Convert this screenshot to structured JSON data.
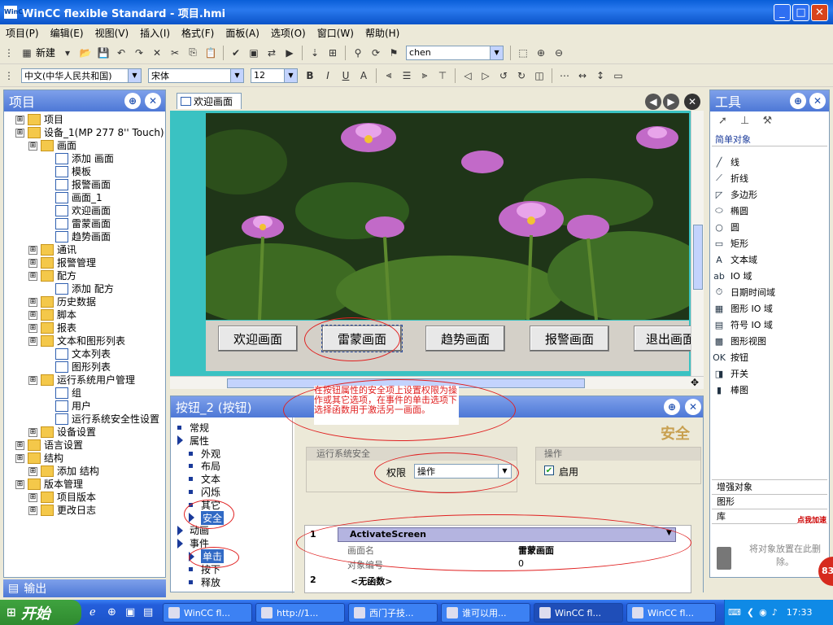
{
  "window": {
    "title": "WinCC flexible Standard - 项目.hmi",
    "app_icon": "WinCC"
  },
  "menu": [
    "项目(P)",
    "编辑(E)",
    "视图(V)",
    "插入(I)",
    "格式(F)",
    "面板(A)",
    "选项(O)",
    "窗口(W)",
    "帮助(H)"
  ],
  "toolbar": {
    "new_label": "新建",
    "user_combo": "chen",
    "language_combo": "中文(中华人民共和国)",
    "font_combo": "宋体",
    "size_combo": "12"
  },
  "project": {
    "title": "项目",
    "items": [
      {
        "label": "项目",
        "level": 0
      },
      {
        "label": "设备_1(MP 277 8'' Touch)",
        "level": 0
      },
      {
        "label": "画面",
        "level": 1
      },
      {
        "label": "添加 画面",
        "level": 2
      },
      {
        "label": "模板",
        "level": 2
      },
      {
        "label": "报警画面",
        "level": 2
      },
      {
        "label": "画面_1",
        "level": 2
      },
      {
        "label": "欢迎画面",
        "level": 2
      },
      {
        "label": "雷蒙画面",
        "level": 2
      },
      {
        "label": "趋势画面",
        "level": 2
      },
      {
        "label": "通讯",
        "level": 1
      },
      {
        "label": "报警管理",
        "level": 1
      },
      {
        "label": "配方",
        "level": 1
      },
      {
        "label": "添加 配方",
        "level": 2
      },
      {
        "label": "历史数据",
        "level": 1
      },
      {
        "label": "脚本",
        "level": 1
      },
      {
        "label": "报表",
        "level": 1
      },
      {
        "label": "文本和图形列表",
        "level": 1
      },
      {
        "label": "文本列表",
        "level": 2
      },
      {
        "label": "图形列表",
        "level": 2
      },
      {
        "label": "运行系统用户管理",
        "level": 1
      },
      {
        "label": "组",
        "level": 2
      },
      {
        "label": "用户",
        "level": 2
      },
      {
        "label": "运行系统安全性设置",
        "level": 2
      },
      {
        "label": "设备设置",
        "level": 1
      },
      {
        "label": "语言设置",
        "level": 0
      },
      {
        "label": "结构",
        "level": 0
      },
      {
        "label": "添加 结构",
        "level": 1
      },
      {
        "label": "版本管理",
        "level": 0
      },
      {
        "label": "项目版本",
        "level": 1
      },
      {
        "label": "更改日志",
        "level": 1
      }
    ]
  },
  "output": {
    "title": "输出"
  },
  "editor": {
    "tab": "欢迎画面",
    "screen_buttons": [
      "欢迎画面",
      "雷蒙画面",
      "趋势画面",
      "报警画面",
      "退出画面"
    ]
  },
  "annotation": {
    "text": "在按钮属性的安全项上设置权限为操作或其它选项，在事件的单击选项下选择函数用于激活另一画面。"
  },
  "properties": {
    "title": "按钮_2 (按钮)",
    "nav": [
      {
        "label": "常规",
        "kind": "item"
      },
      {
        "label": "属性",
        "kind": "group"
      },
      {
        "label": "外观",
        "kind": "item"
      },
      {
        "label": "布局",
        "kind": "item"
      },
      {
        "label": "文本",
        "kind": "item"
      },
      {
        "label": "闪烁",
        "kind": "item"
      },
      {
        "label": "其它",
        "kind": "item"
      },
      {
        "label": "安全",
        "kind": "selected"
      },
      {
        "label": "动画",
        "kind": "group"
      },
      {
        "label": "事件",
        "kind": "group"
      },
      {
        "label": "单击",
        "kind": "selected"
      },
      {
        "label": "按下",
        "kind": "item"
      },
      {
        "label": "释放",
        "kind": "item"
      }
    ],
    "security_heading": "安全",
    "runtime_security": "运行系统安全",
    "permission_label": "权限",
    "permission_value": "操作",
    "operation_label": "操作",
    "enable_label": "启用",
    "function_list": {
      "row1_num": "1",
      "row1_func": "ActivateScreen",
      "param1_label": "画面名",
      "param1_value": "雷蒙画面",
      "param2_label": "对象编号",
      "param2_value": "0",
      "row2_num": "2",
      "row2_func": "<无函数>"
    }
  },
  "tools": {
    "title": "工具",
    "category": "简单对象",
    "items": [
      "线",
      "折线",
      "多边形",
      "椭圆",
      "圆",
      "矩形",
      "文本域",
      "IO 域",
      "日期时间域",
      "图形 IO 域",
      "符号 IO 域",
      "图形视图",
      "按钮",
      "开关",
      "棒图"
    ],
    "sections": [
      "增强对象",
      "图形",
      "库"
    ],
    "library_hint": "将对象放置在此删除。",
    "ad_label": "点我加速",
    "ad_number": "83"
  },
  "taskbar": {
    "start": "开始",
    "tasks": [
      "WinCC fl...",
      "http://1...",
      "西门子技...",
      "谁可以用...",
      "WinCC fl...",
      "WinCC fl..."
    ],
    "clock": "17:33"
  }
}
